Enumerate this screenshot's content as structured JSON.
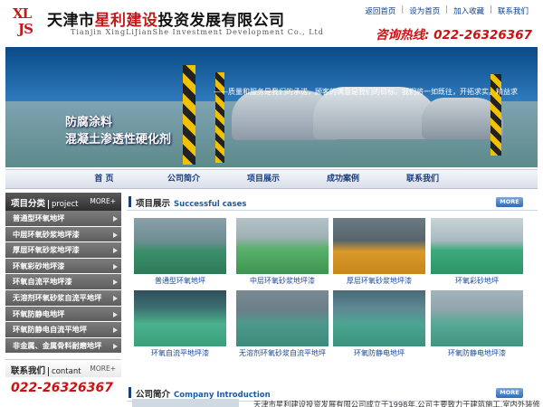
{
  "header": {
    "logo_line1": "XL",
    "logo_line2": "JS",
    "company_name_a": "天津市",
    "company_name_b": "星利建设",
    "company_name_c": "投资发展有限公司",
    "company_en": "Tianjin XingLiJianShe Investment Development Co., Ltd",
    "top_links": [
      "返回首页",
      "设为首页",
      "加入收藏",
      "联系我们"
    ],
    "hotline_label": "咨询热线:",
    "hotline_number": "022-26326367"
  },
  "banner": {
    "slogan": "——质量和服务是我们的承诺，顾客的满意是我们的目标。我们将一如既往，开拓求实。精益求",
    "title_line1": "防腐涂料",
    "title_line2": "混凝土渗透性硬化剂"
  },
  "nav": {
    "items": [
      "首  页",
      "公司简介",
      "项目展示",
      "成功案例",
      "联系我们"
    ]
  },
  "sidebar": {
    "category_title": "项目分类",
    "category_en": "project",
    "category_more": "MORE+",
    "categories": [
      "普通型环氧地坪",
      "中层环氧砂浆地坪漆",
      "厚层环氧砂浆地坪漆",
      "环氧彩砂地坪漆",
      "环氧自流平地坪漆",
      "无溶剂环氧砂浆自流平地坪",
      "环氧防静电地坪",
      "环氧防静电自流平地坪",
      "非金属、金属骨料耐磨地坪"
    ],
    "contact_title": "联系我们",
    "contact_en": "contant",
    "contact_more": "MORE+",
    "contact_phone": "022-26326367"
  },
  "main": {
    "cases_title": "项目展示",
    "cases_en": "Successful cases",
    "cases_more": "MORE",
    "cases": [
      "普通型环氧地坪",
      "中层环氧砂浆地坪漆",
      "厚层环氧砂浆地坪漆",
      "环氧彩砂地坪",
      "环氧自流平地坪漆",
      "无溶剂环氧砂浆自流平地坪",
      "环氧防静电地坪",
      "环氧防静电地坪漆"
    ],
    "intro_title": "公司简介",
    "intro_en": "Company Introduction",
    "intro_more": "MORE",
    "intro_text": "天津市星利建设投资发展有限公司成立于1998年,公司主要致力于建筑施工,室内外装修"
  }
}
